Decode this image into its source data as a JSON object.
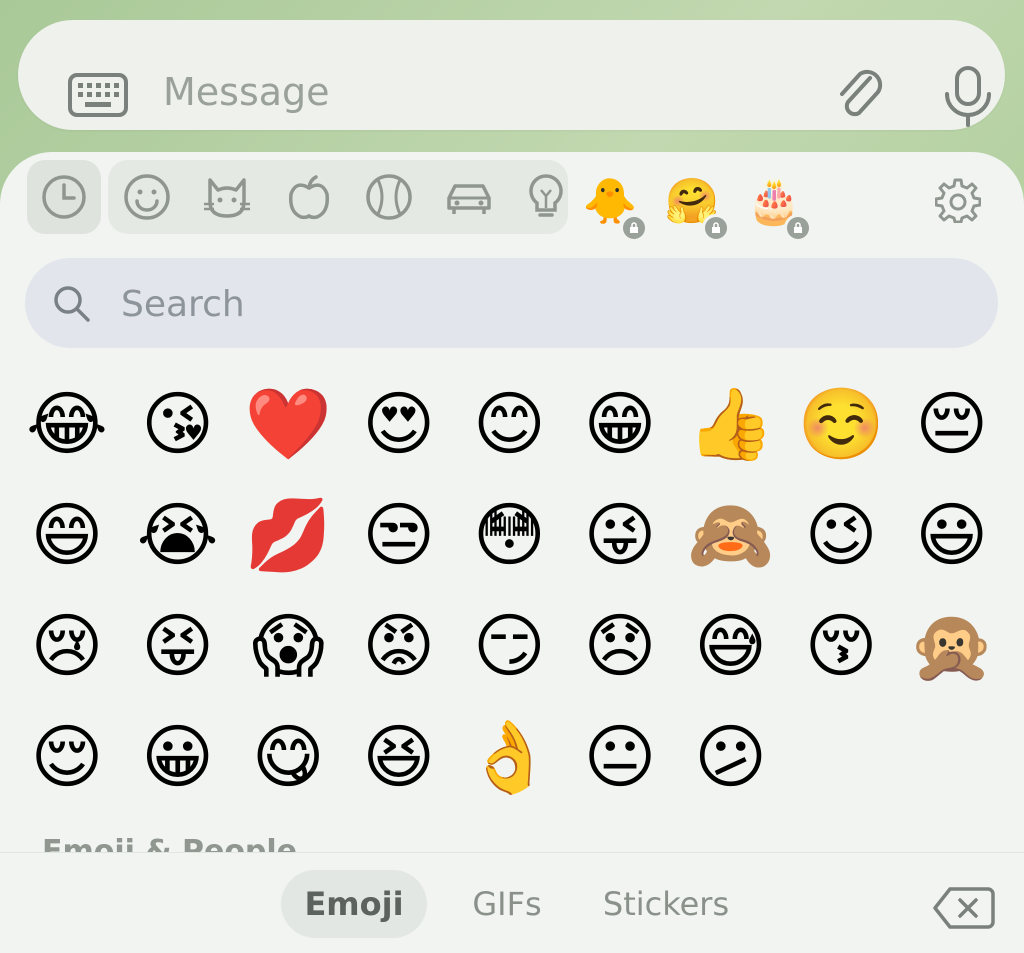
{
  "message_bar": {
    "placeholder": "Message",
    "icons": [
      "keyboard-icon",
      "paperclip-icon",
      "microphone-icon"
    ]
  },
  "categories": {
    "items": [
      "recent-icon",
      "smiley-icon",
      "cat-icon",
      "apple-icon",
      "ball-icon",
      "car-icon",
      "lightbulb-icon"
    ],
    "packs": [
      {
        "emoji": "🐥",
        "locked": true
      },
      {
        "emoji": "🤗",
        "locked": true
      },
      {
        "emoji": "🎂",
        "locked": true
      }
    ]
  },
  "search": {
    "placeholder": "Search"
  },
  "emojis": [
    "😂",
    "😘",
    "❤️",
    "😍",
    "😊",
    "😁",
    "👍",
    "☺️",
    "😔",
    "😄",
    "😭",
    "💋",
    "😒",
    "😳",
    "😜",
    "🙈",
    "😉",
    "😃",
    "😢",
    "😝",
    "😱",
    "😡",
    "😏",
    "😞",
    "😅",
    "😚",
    "🙊",
    "😌",
    "😀",
    "😋",
    "😆",
    "👌",
    "😐",
    "😕"
  ],
  "section_title": "Emoji & People",
  "tabs": [
    {
      "label": "Emoji",
      "active": true
    },
    {
      "label": "GIFs",
      "active": false
    },
    {
      "label": "Stickers",
      "active": false
    }
  ],
  "colors": {
    "accent": "#a9c998",
    "panel": "#f1f4f0",
    "icon": "#9aa09a"
  }
}
